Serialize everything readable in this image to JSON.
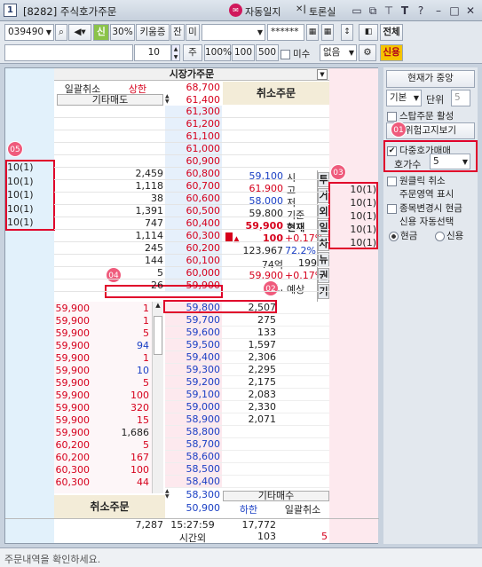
{
  "window": {
    "num": "1",
    "title": "[8282] 주식호가주문",
    "link1": "자동일지",
    "link2": "토론실"
  },
  "toolbar": {
    "code": "039490",
    "credit": "신",
    "pct": "30%",
    "broker": "키움증",
    "jan": "잔",
    "mi": "미",
    "password": "******",
    "all": "전체",
    "sinyong": "신용",
    "qty": "10",
    "unit": "주",
    "b100p": "100%",
    "b100": "100",
    "b500": "500",
    "misu": "미수",
    "none": "없음"
  },
  "header": {
    "market_order": "시장가주문",
    "cancel_all": "일괄취소",
    "upper": "상한",
    "upper_price": "68,700",
    "other_sell": "기타매도",
    "price_61400": "61,400",
    "cancel_order": "취소주문"
  },
  "asks": [
    {
      "price": "61,300"
    },
    {
      "price": "61,200"
    },
    {
      "price": "61,100"
    },
    {
      "price": "61,000"
    },
    {
      "price": "60,900"
    },
    {
      "price": "60,800",
      "vol": "2,459"
    },
    {
      "price": "60,700",
      "vol": "1,118"
    },
    {
      "price": "60,600",
      "vol": "38"
    },
    {
      "price": "60,500",
      "vol": "1,391"
    },
    {
      "price": "60,400",
      "vol": "747"
    },
    {
      "price": "60,300",
      "vol": "1,114"
    },
    {
      "price": "60,200",
      "vol": "245"
    },
    {
      "price": "60,100",
      "vol": "144"
    },
    {
      "price": "60,000",
      "vol": "5"
    },
    {
      "price": "59,900",
      "vol": "26"
    }
  ],
  "left_orders": [
    "10(1)",
    "10(1)",
    "10(1)",
    "10(1)",
    "10(1)"
  ],
  "right_orders": [
    "10(1)",
    "10(1)",
    "10(1)",
    "10(1)",
    "10(1)"
  ],
  "info": [
    {
      "val": "59,100",
      "label": "시"
    },
    {
      "val": "61,900",
      "label": "고"
    },
    {
      "val": "58,000",
      "label": "저"
    },
    {
      "val": "59,800",
      "label": "기준"
    },
    {
      "val": "59,900",
      "label": "현재"
    },
    {
      "val": "100",
      "pct": "+0.17%"
    },
    {
      "val": "123,967",
      "pct": "72.2%"
    },
    {
      "val": "74억",
      "extra": "199"
    },
    {
      "val": "59,900",
      "pct": "+0.17%"
    },
    {
      "val": "1,",
      "label": "예상"
    }
  ],
  "vtabs": [
    "투",
    "거",
    "외",
    "일",
    "차",
    "뉴",
    "권",
    "기"
  ],
  "bids": [
    {
      "price": "59,800",
      "vol": "2,507"
    },
    {
      "price": "59,700",
      "vol": "275"
    },
    {
      "price": "59,600",
      "vol": "133"
    },
    {
      "price": "59,500",
      "vol": "1,597"
    },
    {
      "price": "59,400",
      "vol": "2,306"
    },
    {
      "price": "59,300",
      "vol": "2,295"
    },
    {
      "price": "59,200",
      "vol": "2,175"
    },
    {
      "price": "59,100",
      "vol": "2,083"
    },
    {
      "price": "59,000",
      "vol": "2,330"
    },
    {
      "price": "58,900",
      "vol": "2,071"
    },
    {
      "price": "58,800"
    },
    {
      "price": "58,700"
    },
    {
      "price": "58,600"
    },
    {
      "price": "58,500"
    },
    {
      "price": "58,400"
    },
    {
      "price": "58,300"
    }
  ],
  "trades": [
    {
      "p": "59,900",
      "v": "1"
    },
    {
      "p": "59,900",
      "v": "1"
    },
    {
      "p": "59,900",
      "v": "5"
    },
    {
      "p": "59,900",
      "v": "94"
    },
    {
      "p": "59,900",
      "v": "1"
    },
    {
      "p": "59,900",
      "v": "10"
    },
    {
      "p": "59,900",
      "v": "5"
    },
    {
      "p": "59,900",
      "v": "100"
    },
    {
      "p": "59,900",
      "v": "320"
    },
    {
      "p": "59,900",
      "v": "15"
    },
    {
      "p": "59,900",
      "v": "1,686"
    },
    {
      "p": "60,200",
      "v": "5"
    },
    {
      "p": "60,200",
      "v": "167"
    },
    {
      "p": "60,300",
      "v": "100"
    },
    {
      "p": "60,300",
      "v": "44"
    }
  ],
  "footer": {
    "cancel_order": "취소주문",
    "other_buy": "기타매수",
    "low_price": "50,900",
    "lower": "하한",
    "cancel_all": "일괄취소",
    "total_ask": "7,287",
    "time": "15:27:59",
    "total_bid": "17,772",
    "after_hours": "시간외",
    "ah_vol": "103",
    "ah_val": "5"
  },
  "side": {
    "center_btn": "현재가 중앙",
    "basic": "기본",
    "unit": "단위",
    "unit_val": "5",
    "stop_order": "스탑주문 활성",
    "risk": "위험고지보기",
    "multi": "다중호가매매",
    "hoga_count": "호가수",
    "hoga_val": "5",
    "oneclick": "원클릭 취소",
    "order_area": "주문영역 표시",
    "stock_change": "종목변경시 현금",
    "credit_auto": "신용 자동선택",
    "cash": "현금",
    "credit": "신용"
  },
  "badges": [
    "01",
    "02",
    "03",
    "04",
    "05"
  ],
  "status": "주문내역을 확인하세요."
}
